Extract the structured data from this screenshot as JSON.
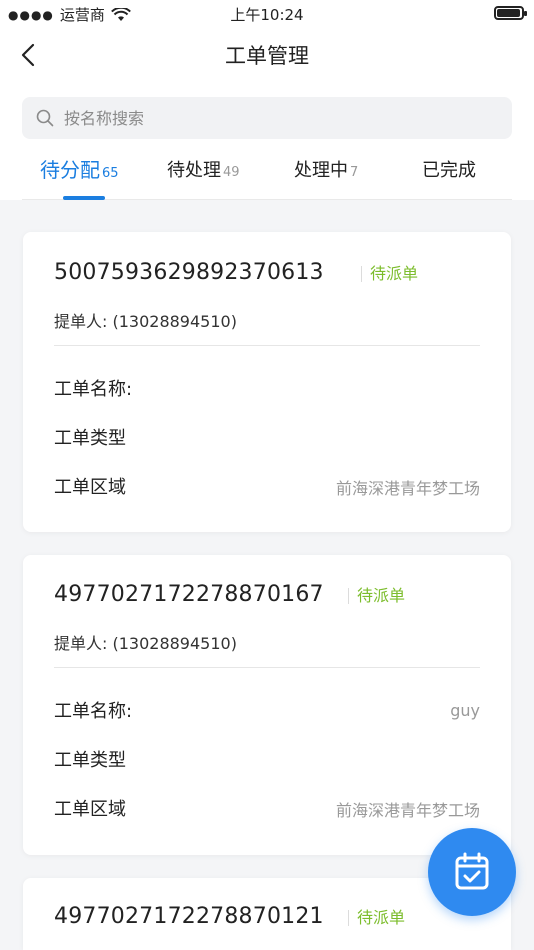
{
  "status_bar": {
    "carrier": "运营商",
    "time": "上午10:24",
    "battery_level": 0.9
  },
  "nav": {
    "title": "工单管理"
  },
  "search": {
    "placeholder": "按名称搜索"
  },
  "tabs": [
    {
      "label": "待分配",
      "count": "65",
      "active": true
    },
    {
      "label": "待处理",
      "count": "49",
      "active": false
    },
    {
      "label": "处理中",
      "count": "7",
      "active": false
    },
    {
      "label": "已完成",
      "count": "",
      "active": false
    }
  ],
  "field_labels": {
    "name": "工单名称:",
    "type": "工单类型",
    "area": "工单区域"
  },
  "orders": [
    {
      "number": "5007593629892370613",
      "status": "待派单",
      "submitter": "提单人: (13028894510)",
      "name": "",
      "type": "",
      "area": "前海深港青年梦工场"
    },
    {
      "number": "4977027172278870167",
      "status": "待派单",
      "submitter": "提单人: (13028894510)",
      "name": "guy",
      "type": "",
      "area": "前海深港青年梦工场"
    },
    {
      "number": "4977027172278870121",
      "status": "待派单"
    }
  ],
  "colors": {
    "accent": "#1b7ee0",
    "status_green": "#7cbd2c",
    "fab": "#2f8af0"
  },
  "icons": {
    "back": "chevron-left-icon",
    "search": "search-icon",
    "fab": "clipboard-check-icon"
  }
}
